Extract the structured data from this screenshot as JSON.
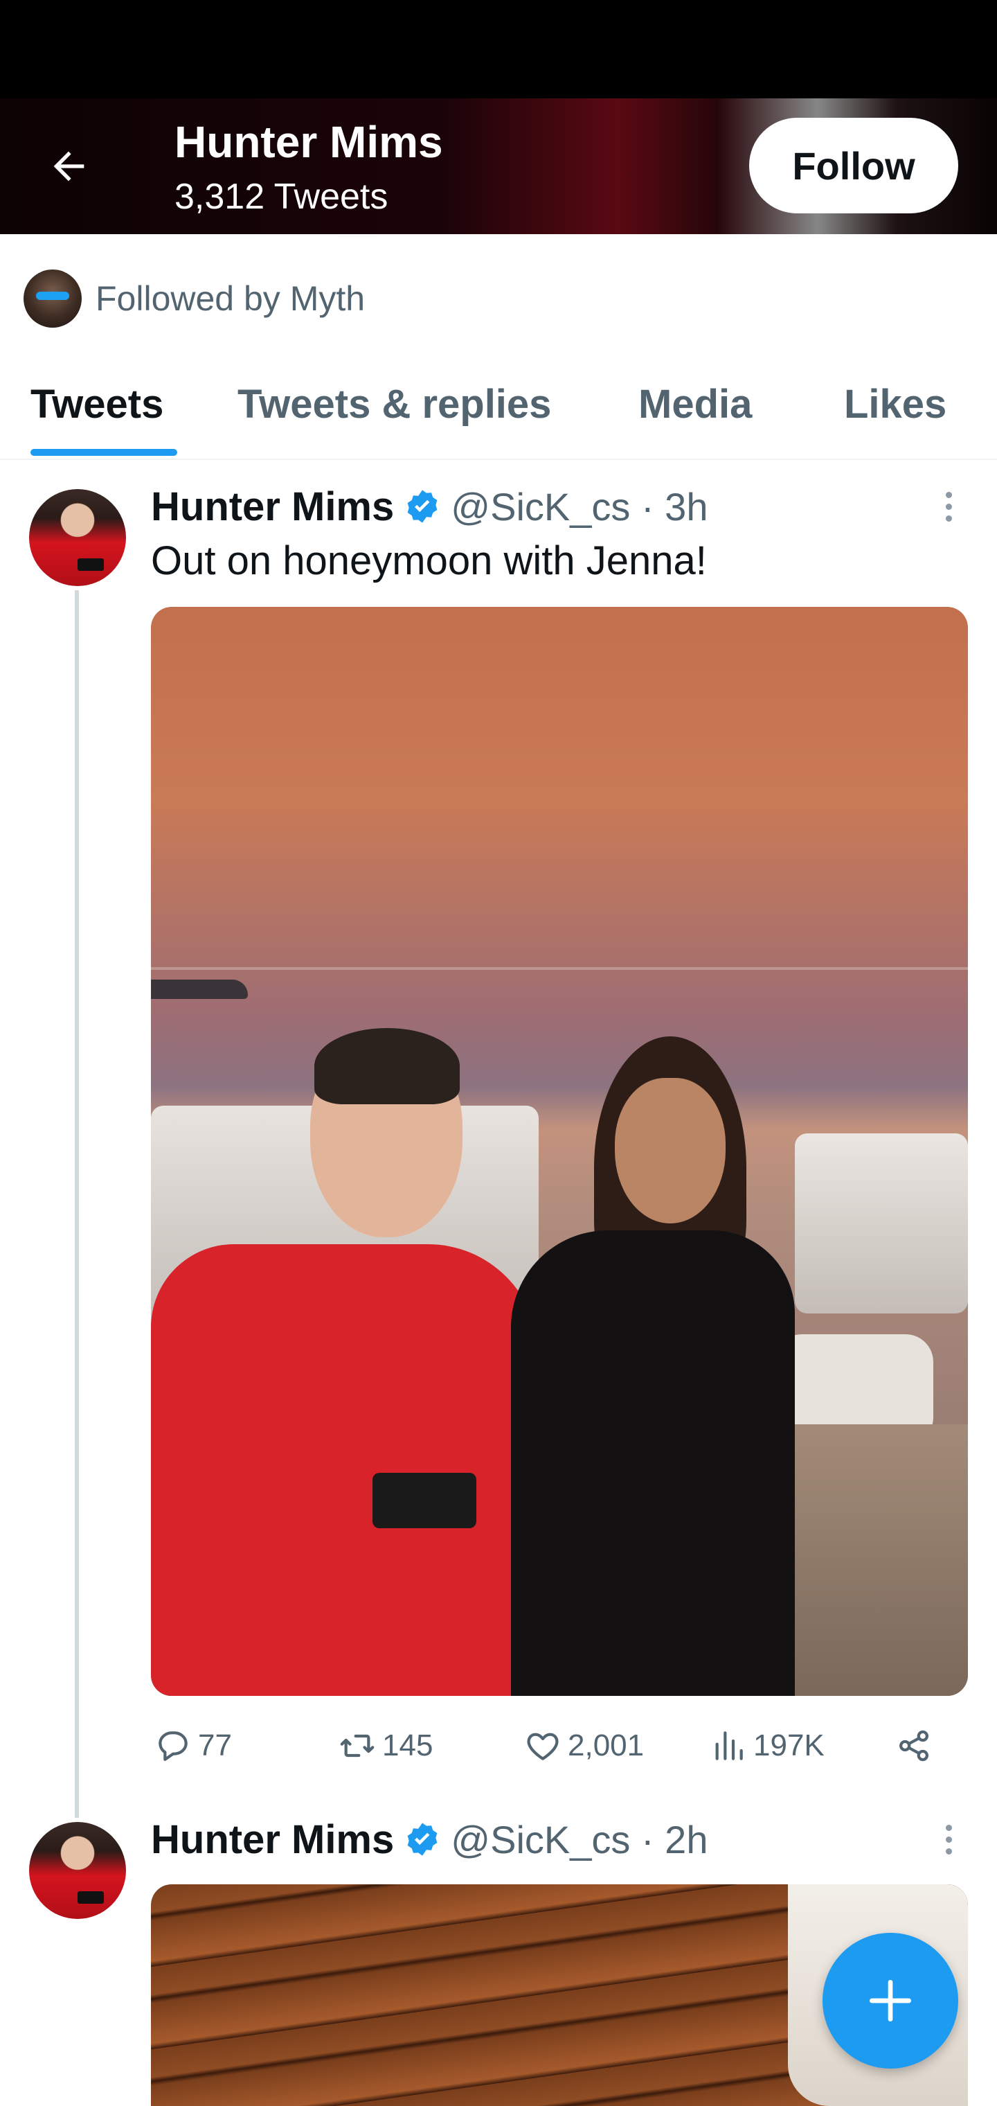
{
  "header": {
    "name": "Hunter Mims",
    "tweet_count": "3,312 Tweets",
    "follow_label": "Follow"
  },
  "followed_by": {
    "text": "Followed by Myth"
  },
  "tabs": [
    {
      "label": "Tweets",
      "active": true
    },
    {
      "label": "Tweets & replies",
      "active": false
    },
    {
      "label": "Media",
      "active": false
    },
    {
      "label": "Likes",
      "active": false
    }
  ],
  "tweets": [
    {
      "name": "Hunter Mims",
      "meta": "@SicK_cs · 3h",
      "text": "Out on honeymoon with Jenna!",
      "replies": "77",
      "retweets": "145",
      "likes": "2,001",
      "views": "197K"
    },
    {
      "name": "Hunter Mims",
      "meta": "@SicK_cs · 2h"
    }
  ],
  "colors": {
    "accent": "#1d9bf0",
    "secondary_text": "#536471",
    "thread_line": "#cfd9de"
  },
  "icons": {
    "back": "arrow-left-icon",
    "verified": "verified-badge-icon",
    "reply": "comment-icon",
    "retweet": "retweet-icon",
    "like": "heart-icon",
    "views": "bar-chart-icon",
    "share": "share-icon",
    "compose": "plus-icon"
  }
}
